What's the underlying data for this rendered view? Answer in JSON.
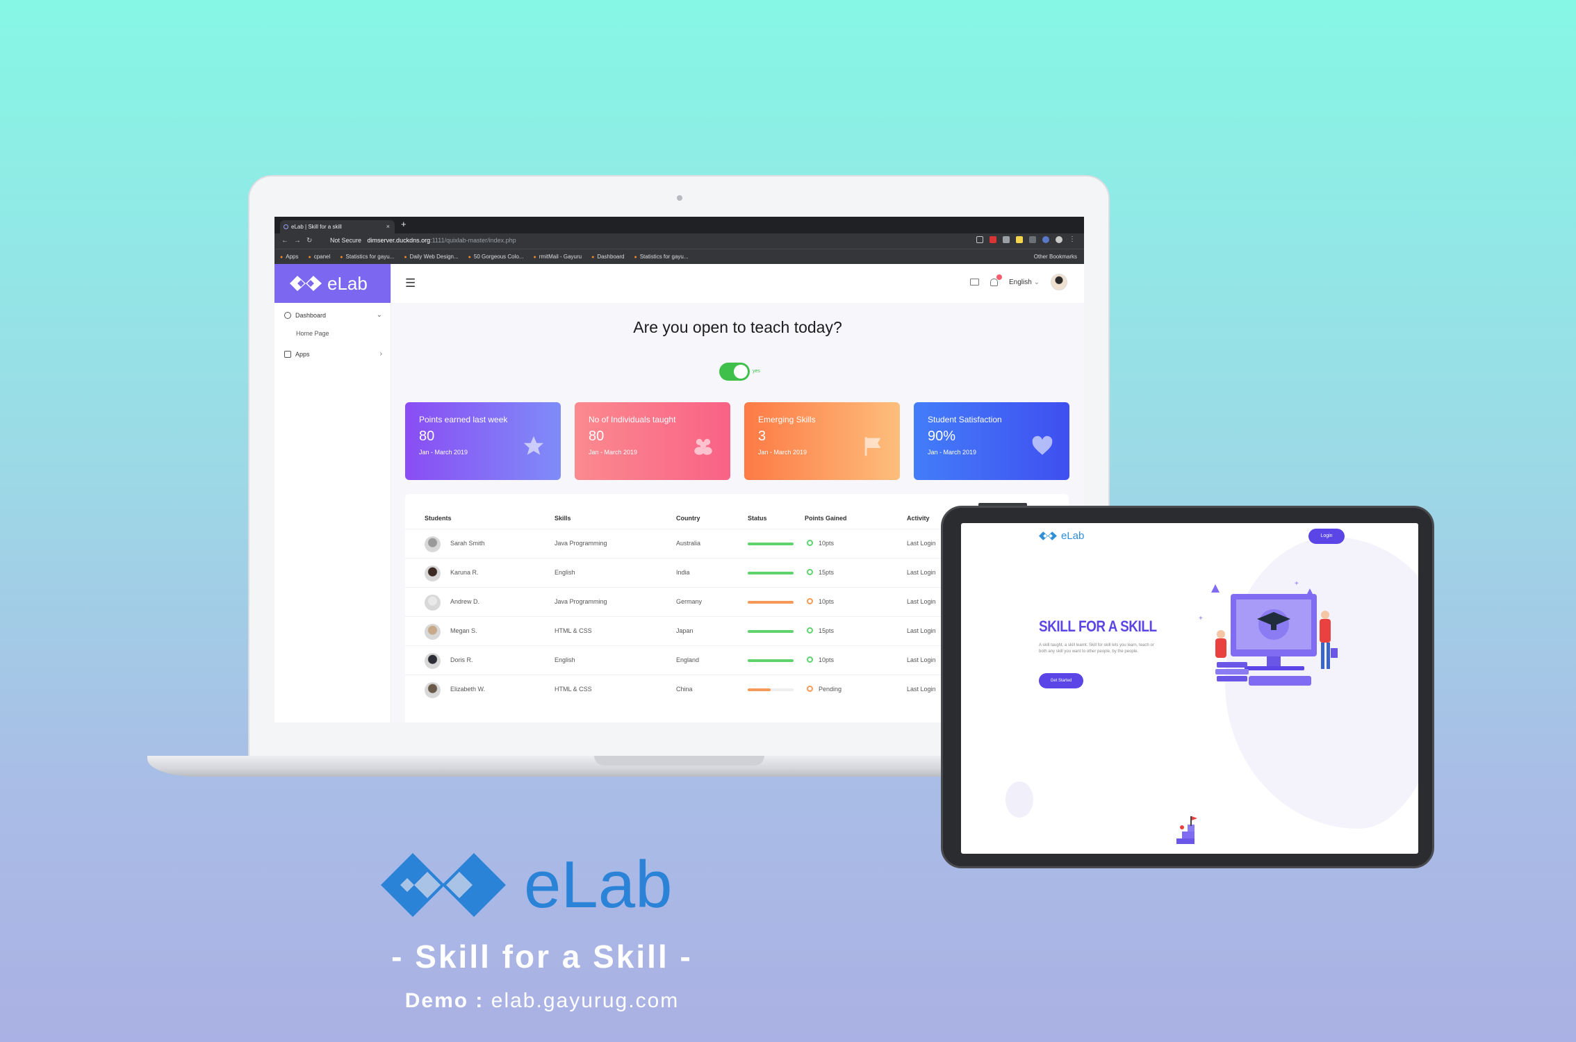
{
  "browser": {
    "tab_title": "eLab | Skill for a skill",
    "new_tab": "+",
    "security": "Not Secure",
    "url_domain": "dimserver.duckdns.org",
    "url_path": ":1111/quixlab-master/index.php",
    "bookmarks": [
      "Apps",
      "cpanel",
      "Statistics for gayu...",
      "Daily Web Design...",
      "50 Gorgeous Colo...",
      "rmitMail - Gayuru",
      "Dashboard",
      "Statistics for gayu..."
    ],
    "other_bookmarks": "Other Bookmarks"
  },
  "app": {
    "brand": "eLab",
    "sidebar": {
      "items": [
        {
          "label": "Dashboard",
          "icon": "dashboard-icon"
        },
        {
          "label": "Apps",
          "icon": "apps-icon"
        }
      ],
      "sub_items": [
        "Home Page"
      ]
    },
    "topbar": {
      "language": "English"
    },
    "question": "Are you open to teach today?",
    "toggle_label": "yes",
    "cards": [
      {
        "title": "Points earned last week",
        "value": "80",
        "period": "Jan - March 2019",
        "icon": "star-icon",
        "colors": [
          "#8a4df4",
          "#7f8cf8"
        ]
      },
      {
        "title": "No of Individuals taught",
        "value": "80",
        "period": "Jan - March 2019",
        "icon": "users-icon",
        "colors": [
          "#fb8a8f",
          "#f96286"
        ]
      },
      {
        "title": "Emerging Skills",
        "value": "3",
        "period": "Jan - March 2019",
        "icon": "flag-icon",
        "colors": [
          "#fd7a45",
          "#fdbe7c"
        ]
      },
      {
        "title": "Student Satisfaction",
        "value": "90%",
        "period": "Jan - March 2019",
        "icon": "heart-icon",
        "colors": [
          "#437df9",
          "#3f4ff0"
        ]
      }
    ],
    "table": {
      "headers": [
        "Students",
        "Skills",
        "Country",
        "Status",
        "Points Gained",
        "Activity"
      ],
      "rows": [
        {
          "student": "Sarah Smith",
          "skill": "Java Programming",
          "country": "Australia",
          "status": 1.0,
          "status_color": "#5fd36c",
          "points": "10pts",
          "activity": "Last Login"
        },
        {
          "student": "Karuna R.",
          "skill": "English",
          "country": "India",
          "status": 1.0,
          "status_color": "#5fd36c",
          "points": "15pts",
          "activity": "Last Login"
        },
        {
          "student": "Andrew D.",
          "skill": "Java Programming",
          "country": "Germany",
          "status": 1.0,
          "status_color": "#f79a57",
          "points": "10pts",
          "activity": "Last Login"
        },
        {
          "student": "Megan S.",
          "skill": "HTML & CSS",
          "country": "Japan",
          "status": 1.0,
          "status_color": "#5fd36c",
          "points": "15pts",
          "activity": "Last Login"
        },
        {
          "student": "Doris R.",
          "skill": "English",
          "country": "England",
          "status": 1.0,
          "status_color": "#5fd36c",
          "points": "10pts",
          "activity": "Last Login"
        },
        {
          "student": "Elizabeth W.",
          "skill": "HTML & CSS",
          "country": "China",
          "status": 0.5,
          "status_color": "#f79a57",
          "points": "Pending",
          "activity": "Last Login"
        }
      ]
    }
  },
  "tablet": {
    "brand": "eLab",
    "login": "Login",
    "headline": "SKILL FOR A SKILL",
    "subtext": "A skill taught, a skill learnt. Skill for skill lets you learn, teach or both any skill you want to other people, by the people.",
    "cta": "Get Started"
  },
  "footer": {
    "wordmark": "eLab",
    "tagline": "- Skill for a Skill -",
    "demo_label": "Demo :",
    "demo_url": "elab.gayurug.com"
  }
}
